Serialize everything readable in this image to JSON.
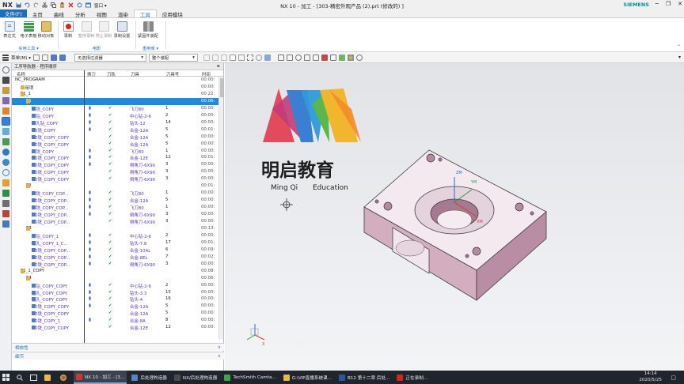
{
  "titlebar": {
    "app": "NX",
    "window_menu": "窗口 ▾",
    "title": "NX 10 - 加工 - [303-精密外观产品 (2).prt  (修改的) ]",
    "brand": "SIEMENS",
    "minimize": "─",
    "restore": "❐",
    "close": "✕"
  },
  "tabs": [
    "文件(F)",
    "主页",
    "曲线",
    "分析",
    "视图",
    "渲染",
    "工具",
    "应用模块"
  ],
  "ribbon": {
    "groups": [
      {
        "label": "实用工具 ▾",
        "buttons": [
          "表达式",
          "电子表格",
          "移动对象"
        ]
      },
      {
        "label": "电影",
        "buttons": [
          "录制",
          "暂停录制",
          "停止录制",
          "录制设置"
        ]
      },
      {
        "label": "重用库 ▾",
        "buttons": [
          "紧固件装配"
        ]
      }
    ]
  },
  "toolbar": {
    "menu": "菜单(M) ▾",
    "filter_select": "无选择过滤器",
    "assembly_select": "整个装配"
  },
  "navigator": {
    "title": "工序导航器 - 程序顺序",
    "columns": [
      "名称",
      "换刀",
      "刀轨",
      "刀具",
      "刀具号",
      "时间"
    ],
    "rows": [
      {
        "indent": 0,
        "name": "NC_PROGRAM",
        "tc": "",
        "path": "",
        "tool": "",
        "tn": "",
        "time": "00:00:",
        "kind": "root"
      },
      {
        "indent": 1,
        "name": "未用项",
        "tc": "",
        "path": "",
        "tool": "",
        "tn": "",
        "time": "00:00:",
        "kind": "folder"
      },
      {
        "indent": 1,
        "name": "P1_1",
        "tc": "",
        "path": "",
        "tool": "",
        "tn": "",
        "time": "00:22:",
        "kind": "group"
      },
      {
        "indent": 2,
        "name": "P1",
        "tc": "",
        "path": "",
        "tool": "",
        "tn": "",
        "time": "00:06:",
        "kind": "group",
        "selected": true
      },
      {
        "indent": 3,
        "name": "面铣_COPY",
        "tc": "▮",
        "path": "✔",
        "tool": "飞刀80",
        "tn": "1",
        "time": "00:00:",
        "kind": "op"
      },
      {
        "indent": 3,
        "name": "点钻_COPY",
        "tc": "▮",
        "path": "✔",
        "tool": "中心钻-2-6",
        "tn": "2",
        "time": "00:00:",
        "kind": "op"
      },
      {
        "indent": 3,
        "name": "深孔钻_COPY",
        "tc": "▮",
        "path": "✔",
        "tool": "钻头-12",
        "tn": "14",
        "time": "00:00:",
        "kind": "op"
      },
      {
        "indent": 3,
        "name": "2D铣_COPY",
        "tc": "▮",
        "path": "✔",
        "tool": "合金-12A",
        "tn": "5",
        "time": "00:01:",
        "kind": "op"
      },
      {
        "indent": 3,
        "name": "2D铣_COPY_COPY",
        "tc": "",
        "path": "✔",
        "tool": "合金-12A",
        "tn": "5",
        "time": "00:00:",
        "kind": "op"
      },
      {
        "indent": 3,
        "name": "2D铣_COPY_COPY",
        "tc": "",
        "path": "✔",
        "tool": "合金-12A",
        "tn": "5",
        "time": "00:00:",
        "kind": "op"
      },
      {
        "indent": 3,
        "name": "面铣_COPY",
        "tc": "▮",
        "path": "✔",
        "tool": "飞刀80",
        "tn": "1",
        "time": "00:00:",
        "kind": "op"
      },
      {
        "indent": 3,
        "name": "2D铣_COPY_COPY",
        "tc": "▮",
        "path": "✔",
        "tool": "合金-12E",
        "tn": "12",
        "time": "00:01:",
        "kind": "op"
      },
      {
        "indent": 3,
        "name": "2D铣_COPY_COPY",
        "tc": "▮",
        "path": "✔",
        "tool": "倒角刀-6X90",
        "tn": "3",
        "time": "00:00:",
        "kind": "op"
      },
      {
        "indent": 3,
        "name": "2D铣_COPY_COPY",
        "tc": "",
        "path": "✔",
        "tool": "倒角刀-6X90",
        "tn": "3",
        "time": "00:00:",
        "kind": "op"
      },
      {
        "indent": 3,
        "name": "2D铣_COPY_COPY",
        "tc": "",
        "path": "✔",
        "tool": "倒角刀-6X90",
        "tn": "3",
        "time": "00:00:",
        "kind": "op"
      },
      {
        "indent": 2,
        "name": "P2",
        "tc": "",
        "path": "",
        "tool": "",
        "tn": "",
        "time": "00:01:",
        "kind": "group"
      },
      {
        "indent": 3,
        "name": "面铣_COPY_COP...",
        "tc": "▮",
        "path": "✔",
        "tool": "飞刀80",
        "tn": "1",
        "time": "00:00:",
        "kind": "op"
      },
      {
        "indent": 3,
        "name": "2D铣_COPY_COP...",
        "tc": "▮",
        "path": "✔",
        "tool": "合金-12A",
        "tn": "5",
        "time": "00:00:",
        "kind": "op"
      },
      {
        "indent": 3,
        "name": "面铣_COPY_COP...",
        "tc": "▮",
        "path": "✔",
        "tool": "飞刀80",
        "tn": "1",
        "time": "00:00:",
        "kind": "op"
      },
      {
        "indent": 3,
        "name": "2D铣_COPY_COP...",
        "tc": "▮",
        "path": "✔",
        "tool": "倒角刀-6X90",
        "tn": "3",
        "time": "00:00:",
        "kind": "op"
      },
      {
        "indent": 3,
        "name": "2D铣_COPY_COP...",
        "tc": "",
        "path": "✔",
        "tool": "倒角刀-6X90",
        "tn": "3",
        "time": "00:00:",
        "kind": "op"
      },
      {
        "indent": 2,
        "name": "P3",
        "tc": "",
        "path": "",
        "tool": "",
        "tn": "",
        "time": "00:13:",
        "kind": "group"
      },
      {
        "indent": 3,
        "name": "点钻_COPY_1",
        "tc": "▮",
        "path": "✔",
        "tool": "中心钻-2-6",
        "tn": "2",
        "time": "00:00:",
        "kind": "op"
      },
      {
        "indent": 3,
        "name": "钻孔_COPY_1_C...",
        "tc": "▮",
        "path": "✔",
        "tool": "钻头-7.8",
        "tn": "17",
        "time": "00:01:",
        "kind": "op"
      },
      {
        "indent": 3,
        "name": "2D铣_COPY_COP...",
        "tc": "▮",
        "path": "✔",
        "tool": "合金-10AL",
        "tn": "6",
        "time": "00:09:",
        "kind": "op"
      },
      {
        "indent": 3,
        "name": "2D铣_COPY_COP...",
        "tc": "▮",
        "path": "✔",
        "tool": "合金-8EL",
        "tn": "7",
        "time": "00:02:",
        "kind": "op"
      },
      {
        "indent": 3,
        "name": "2D铣_COPY_COP...",
        "tc": "▮",
        "path": "✔",
        "tool": "倒角刀-6X90",
        "tn": "3",
        "time": "00:00:",
        "kind": "op"
      },
      {
        "indent": 1,
        "name": "P1_1_COPY",
        "tc": "",
        "path": "",
        "tool": "",
        "tn": "",
        "time": "00:08:",
        "kind": "group"
      },
      {
        "indent": 2,
        "name": "P4",
        "tc": "",
        "path": "",
        "tool": "",
        "tn": "",
        "time": "00:06:",
        "kind": "group"
      },
      {
        "indent": 3,
        "name": "点钻_COPY_COPY",
        "tc": "▮",
        "path": "✔",
        "tool": "中心钻-2-6",
        "tn": "2",
        "time": "00:00:",
        "kind": "op"
      },
      {
        "indent": 3,
        "name": "钻孔_COPY_COPY",
        "tc": "▮",
        "path": "✔",
        "tool": "钻头-3.3",
        "tn": "15",
        "time": "00:00:",
        "kind": "op"
      },
      {
        "indent": 3,
        "name": "钻孔_COPY_COPY",
        "tc": "▮",
        "path": "✔",
        "tool": "钻头-4",
        "tn": "16",
        "time": "00:00:",
        "kind": "op"
      },
      {
        "indent": 3,
        "name": "2D铣_COPY_COPY",
        "tc": "▮",
        "path": "✔",
        "tool": "合金-12A",
        "tn": "5",
        "time": "00:00:",
        "kind": "op"
      },
      {
        "indent": 3,
        "name": "2D铣_COPY_COPY",
        "tc": "",
        "path": "✔",
        "tool": "合金-12A",
        "tn": "5",
        "time": "00:00:",
        "kind": "op"
      },
      {
        "indent": 3,
        "name": "2D铣_COPY_1",
        "tc": "▮",
        "path": "✔",
        "tool": "合金-8A",
        "tn": "8",
        "time": "00:00:",
        "kind": "op"
      },
      {
        "indent": 3,
        "name": "2D铣_COPY_COPY",
        "tc": "",
        "path": "✔",
        "tool": "合金-12E",
        "tn": "12",
        "time": "00:00:",
        "kind": "op"
      }
    ],
    "panels": [
      {
        "label": "相依性",
        "chevron": "∨"
      },
      {
        "label": "细节",
        "chevron": "∨"
      }
    ]
  },
  "viewport": {
    "logo_cn": "明启教育",
    "logo_en1": "Ming Qi",
    "logo_en2": "Education",
    "axis_zm": "ZM",
    "axis_ym": "YM",
    "axis_xm": "XM",
    "triad_x": "X"
  },
  "taskbar": {
    "items": [
      {
        "label": "NX 10 - 加工 - [3...",
        "active": true
      },
      {
        "label": "后处理构造器",
        "active": false
      },
      {
        "label": "NX/后处理构造器",
        "active": false
      },
      {
        "label": "TechSmith Camta...",
        "active": false
      },
      {
        "label": "G:\\VIP直播系统课...",
        "active": false
      },
      {
        "label": "B12 第十二章 后处...",
        "active": false
      },
      {
        "label": "正在录制...",
        "active": false
      }
    ],
    "time": "14:14",
    "date": "2020/5/25"
  },
  "colors": {
    "accent": "#1e6fb8",
    "selection": "#1b8be0",
    "check": "#1a9c33",
    "part": "#d4b7c8",
    "taskbar": "#20252d"
  }
}
